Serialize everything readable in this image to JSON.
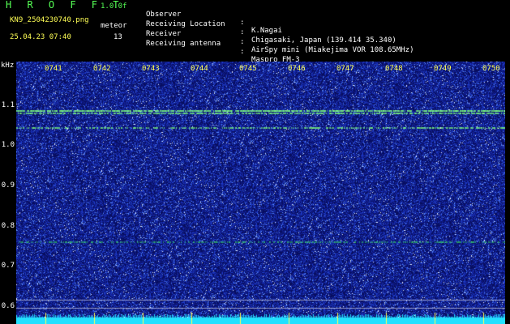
{
  "header": {
    "app_title": "H R O F F T",
    "version": "1.0.0f",
    "filename": "KN9_2504230740.png",
    "meteor_label": "meteor",
    "meteor_count": "13",
    "datetime": "25.04.23 07:40",
    "info": [
      {
        "label": "Observer",
        "value": "K.Nagai"
      },
      {
        "label": "Receiving Location",
        "value": "Chigasaki, Japan (139.414 35.340)"
      },
      {
        "label": "Receiver",
        "value": "AirSpy mini (Miakejima VOR 108.65MHz)"
      },
      {
        "label": "Receiving antenna",
        "value": "Maspro FM-3"
      }
    ],
    "separator": ":"
  },
  "plot": {
    "freq_unit": "kHz",
    "y_ticks": [
      "1.1",
      "1.0",
      "0.9",
      "0.8",
      "0.7",
      "0.6"
    ],
    "x_ticks": [
      "0741",
      "0742",
      "0743",
      "0744",
      "0745",
      "0746",
      "0747",
      "0748",
      "0749",
      "0750"
    ]
  },
  "colors": {
    "background": "#000000",
    "label_green": "#55ff55",
    "label_yellow": "#ffff55",
    "spectrum_base": "#16229a",
    "signal": "#7cff7c",
    "baseline": "#22e0ff"
  }
}
